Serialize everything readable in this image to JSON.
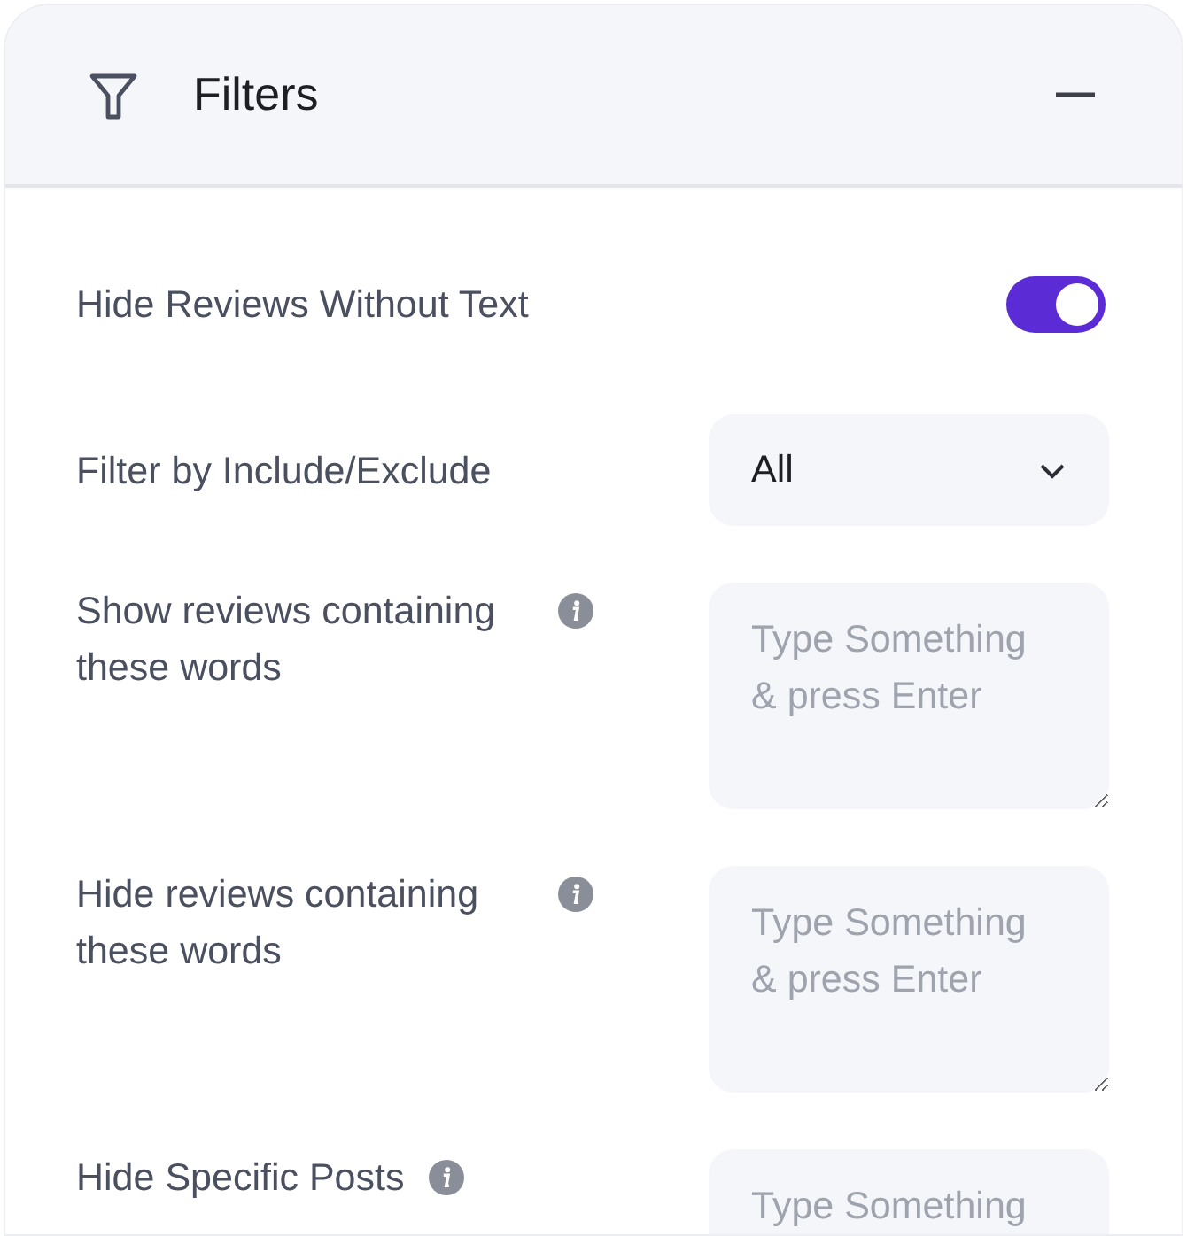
{
  "panel": {
    "title": "Filters",
    "expanded": true
  },
  "filters": [
    {
      "kind": "toggle",
      "label": "Hide Reviews Without Text",
      "on": true,
      "info": false
    },
    {
      "kind": "select",
      "label": "Filter by Include/Exclude",
      "value": "All",
      "info": false
    },
    {
      "kind": "textarea",
      "label": "Show reviews containing these words",
      "placeholder": "Type Something & press Enter",
      "info": true
    },
    {
      "kind": "textarea",
      "label": "Hide reviews containing these words",
      "placeholder": "Type Something & press Enter",
      "info": true
    },
    {
      "kind": "textarea",
      "label": "Hide Specific Posts",
      "placeholder": "Type Something",
      "info": true
    }
  ]
}
